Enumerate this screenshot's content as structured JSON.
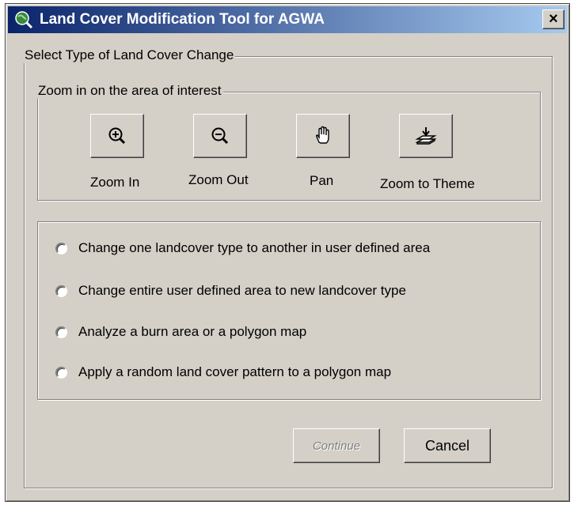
{
  "window": {
    "title": "Land Cover Modification Tool for AGWA",
    "close_label": "×"
  },
  "outer_group": {
    "label": "Select Type of Land Cover Change"
  },
  "zoom_group": {
    "label": "Zoom in on the area of interest",
    "tools": [
      {
        "label": "Zoom In",
        "icon": "zoom-in-icon"
      },
      {
        "label": "Zoom Out",
        "icon": "zoom-out-icon"
      },
      {
        "label": "Pan",
        "icon": "pan-hand-icon"
      },
      {
        "label": "Zoom to Theme",
        "icon": "zoom-to-theme-icon"
      }
    ]
  },
  "options": [
    {
      "label": "Change one landcover type to another in user defined area",
      "selected": false
    },
    {
      "label": "Change entire user defined area to new landcover type",
      "selected": false
    },
    {
      "label": "Analyze a burn area or a polygon map",
      "selected": false
    },
    {
      "label": "Apply a random land cover pattern to a polygon map",
      "selected": false
    }
  ],
  "buttons": {
    "continue_label": "Continue",
    "continue_enabled": false,
    "cancel_label": "Cancel"
  }
}
